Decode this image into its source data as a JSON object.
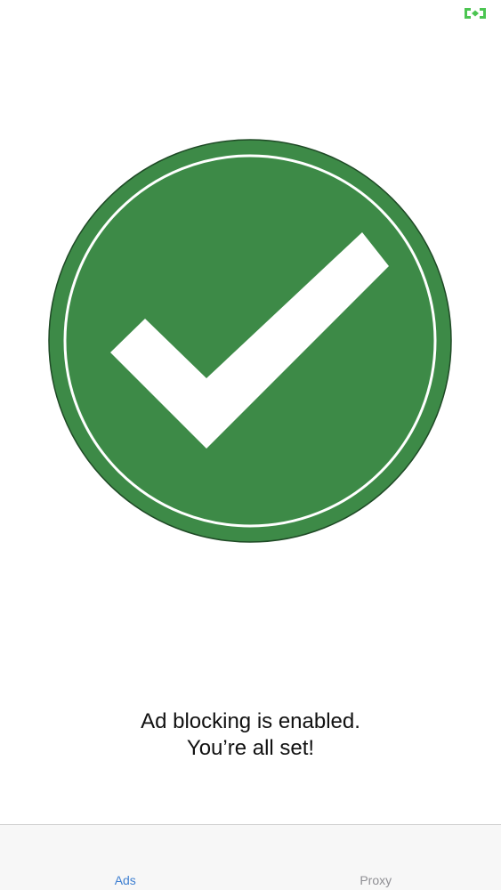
{
  "status_bar": {
    "icon": "fullscreen-arrows-icon",
    "icon_color": "#4cc552"
  },
  "badge": {
    "icon": "checkmark-circle-icon",
    "fill_color": "#3d8a47",
    "ring_color": "#ffffff",
    "check_color": "#ffffff"
  },
  "message": {
    "line1": "Ad blocking is enabled.",
    "line2": "You’re all set!"
  },
  "tabs": [
    {
      "label": "Ads",
      "selected": true,
      "color": "#3e7fd1"
    },
    {
      "label": "Proxy",
      "selected": false,
      "color": "#8e8e93"
    }
  ]
}
